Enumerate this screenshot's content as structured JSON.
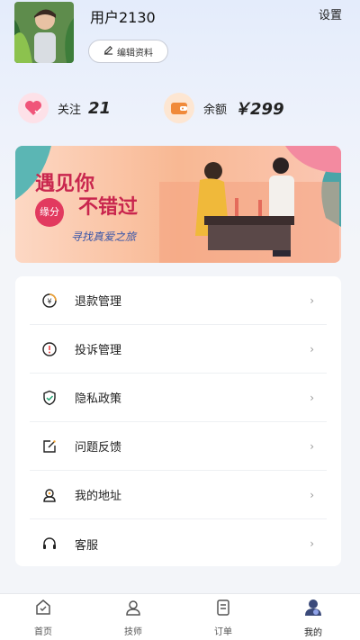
{
  "profile": {
    "username": "用户2130",
    "edit_label": "编辑资料",
    "settings_label": "设置"
  },
  "stats": {
    "follow_label": "关注",
    "follow_value": "21",
    "balance_label": "余额",
    "balance_value": "￥299"
  },
  "banner": {
    "text_line1": "遇见你",
    "text_line2": "不错过",
    "badge_text": "缘分",
    "subtitle": "寻找真爱之旅"
  },
  "menu": {
    "items": [
      {
        "label": "退款管理",
        "icon": "refund-icon"
      },
      {
        "label": "投诉管理",
        "icon": "complaint-icon"
      },
      {
        "label": "隐私政策",
        "icon": "shield-icon"
      },
      {
        "label": "问题反馈",
        "icon": "feedback-icon"
      },
      {
        "label": "我的地址",
        "icon": "address-icon"
      },
      {
        "label": "客服",
        "icon": "headset-icon"
      }
    ]
  },
  "tabs": [
    {
      "label": "首页",
      "icon": "home-icon"
    },
    {
      "label": "技师",
      "icon": "person-icon"
    },
    {
      "label": "订单",
      "icon": "order-icon"
    },
    {
      "label": "我的",
      "icon": "profile-icon",
      "active": true
    }
  ],
  "colors": {
    "accent_pink": "#f0557a",
    "accent_orange": "#f08a3a",
    "tab_active": "#3b4a7a"
  }
}
